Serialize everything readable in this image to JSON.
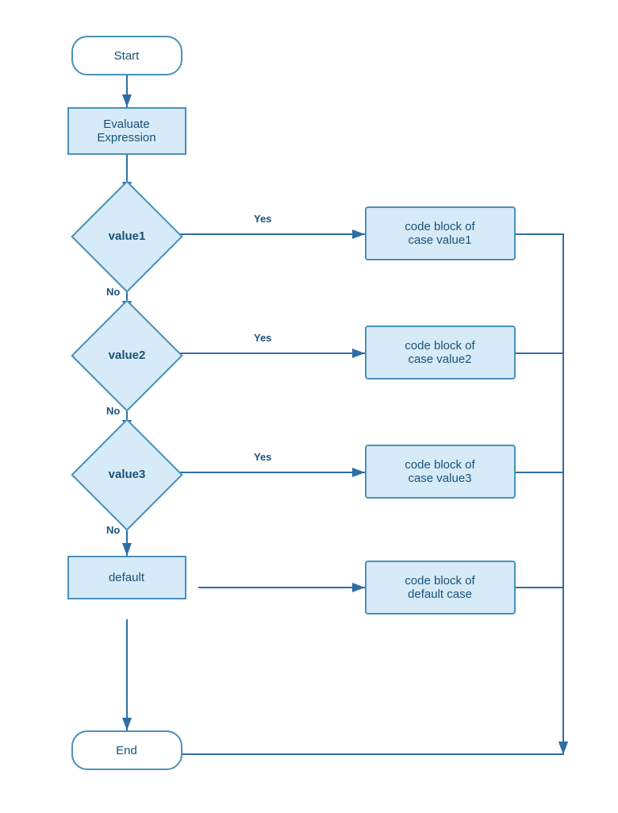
{
  "nodes": {
    "start": {
      "label": "Start"
    },
    "evaluate": {
      "label": "Evaluate\nExpression"
    },
    "value1": {
      "label": "value1"
    },
    "value2": {
      "label": "value2"
    },
    "value3": {
      "label": "value3"
    },
    "default": {
      "label": "default"
    },
    "end": {
      "label": "End"
    },
    "code1": {
      "label": "code block of\ncase value1"
    },
    "code2": {
      "label": "code block of\ncase value2"
    },
    "code3": {
      "label": "code block of\ncase value3"
    },
    "codeDefault": {
      "label": "code block of\ndefault case"
    }
  },
  "arrows": {
    "yes": "Yes",
    "no": "No"
  },
  "colors": {
    "border": "#4a90b8",
    "fill": "#d6eaf8",
    "arrow": "#2e6da4",
    "text": "#1a5276"
  }
}
